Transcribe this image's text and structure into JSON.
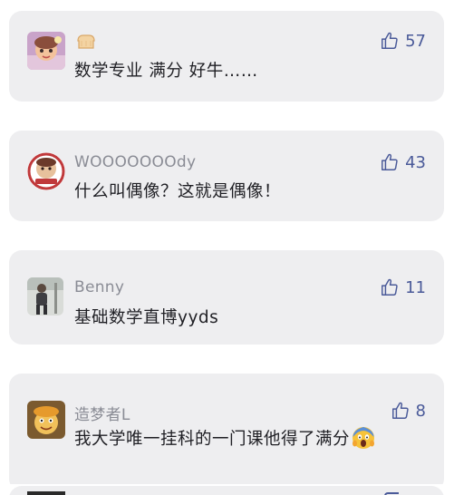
{
  "colors": {
    "card_bg": "#eeeef0",
    "username": "#8a8c95",
    "comment": "#1f1f24",
    "like": "#4a5a99"
  },
  "comments": [
    {
      "username": "",
      "badge_icon": "bread-icon",
      "text": "数学专业 满分 好牛……",
      "likes": "57",
      "avatar_icon": "cartoon-avatar-icon"
    },
    {
      "username": "WOOOOOOOdy",
      "text": "什么叫偶像？这就是偶像！",
      "likes": "43",
      "avatar_icon": "round-badge-avatar-icon"
    },
    {
      "username": "Benny",
      "text": "基础数学直博yyds",
      "likes": "11",
      "avatar_icon": "person-photo-avatar-icon"
    },
    {
      "username": "造梦者L",
      "text": "我大学唯一挂科的一门课他得了满分",
      "text_emoji": "screaming-face-emoji",
      "likes": "8",
      "avatar_icon": "cartoon-character-avatar-icon"
    }
  ]
}
